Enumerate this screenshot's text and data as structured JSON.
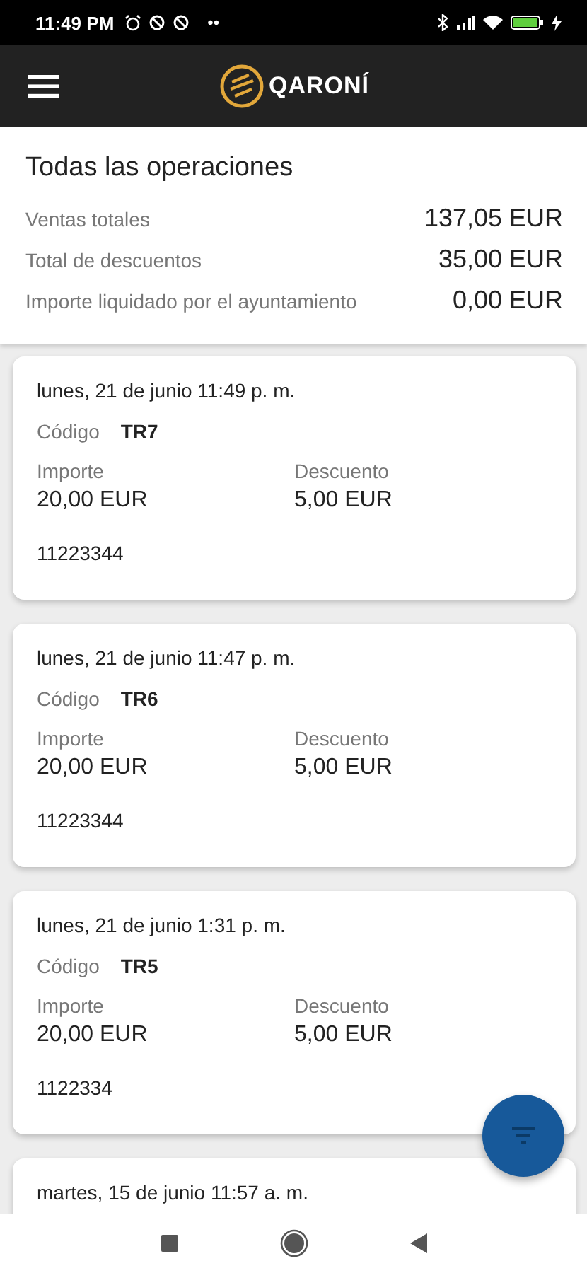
{
  "status_bar": {
    "time": "11:49 PM",
    "dots": "••"
  },
  "app_bar": {
    "logo_text": "QARONÍ"
  },
  "summary": {
    "title": "Todas las operaciones",
    "rows": [
      {
        "label": "Ventas totales",
        "value": "137,05 EUR"
      },
      {
        "label": "Total de descuentos",
        "value": "35,00 EUR"
      },
      {
        "label": "Importe liquidado por el ayuntamiento",
        "value": "0,00 EUR"
      }
    ]
  },
  "operations": [
    {
      "date": "lunes, 21 de junio 11:49 p. m.",
      "code_label": "Código",
      "code": "TR7",
      "amount_label": "Importe",
      "amount": "20,00 EUR",
      "discount_label": "Descuento",
      "discount": "5,00 EUR",
      "reference": "11223344"
    },
    {
      "date": "lunes, 21 de junio 11:47 p. m.",
      "code_label": "Código",
      "code": "TR6",
      "amount_label": "Importe",
      "amount": "20,00 EUR",
      "discount_label": "Descuento",
      "discount": "5,00 EUR",
      "reference": "11223344"
    },
    {
      "date": "lunes, 21 de junio 1:31 p. m.",
      "code_label": "Código",
      "code": "TR5",
      "amount_label": "Importe",
      "amount": "20,00 EUR",
      "discount_label": "Descuento",
      "discount": "5,00 EUR",
      "reference": "1122334"
    },
    {
      "date": "martes, 15 de junio 11:57 a. m."
    }
  ]
}
